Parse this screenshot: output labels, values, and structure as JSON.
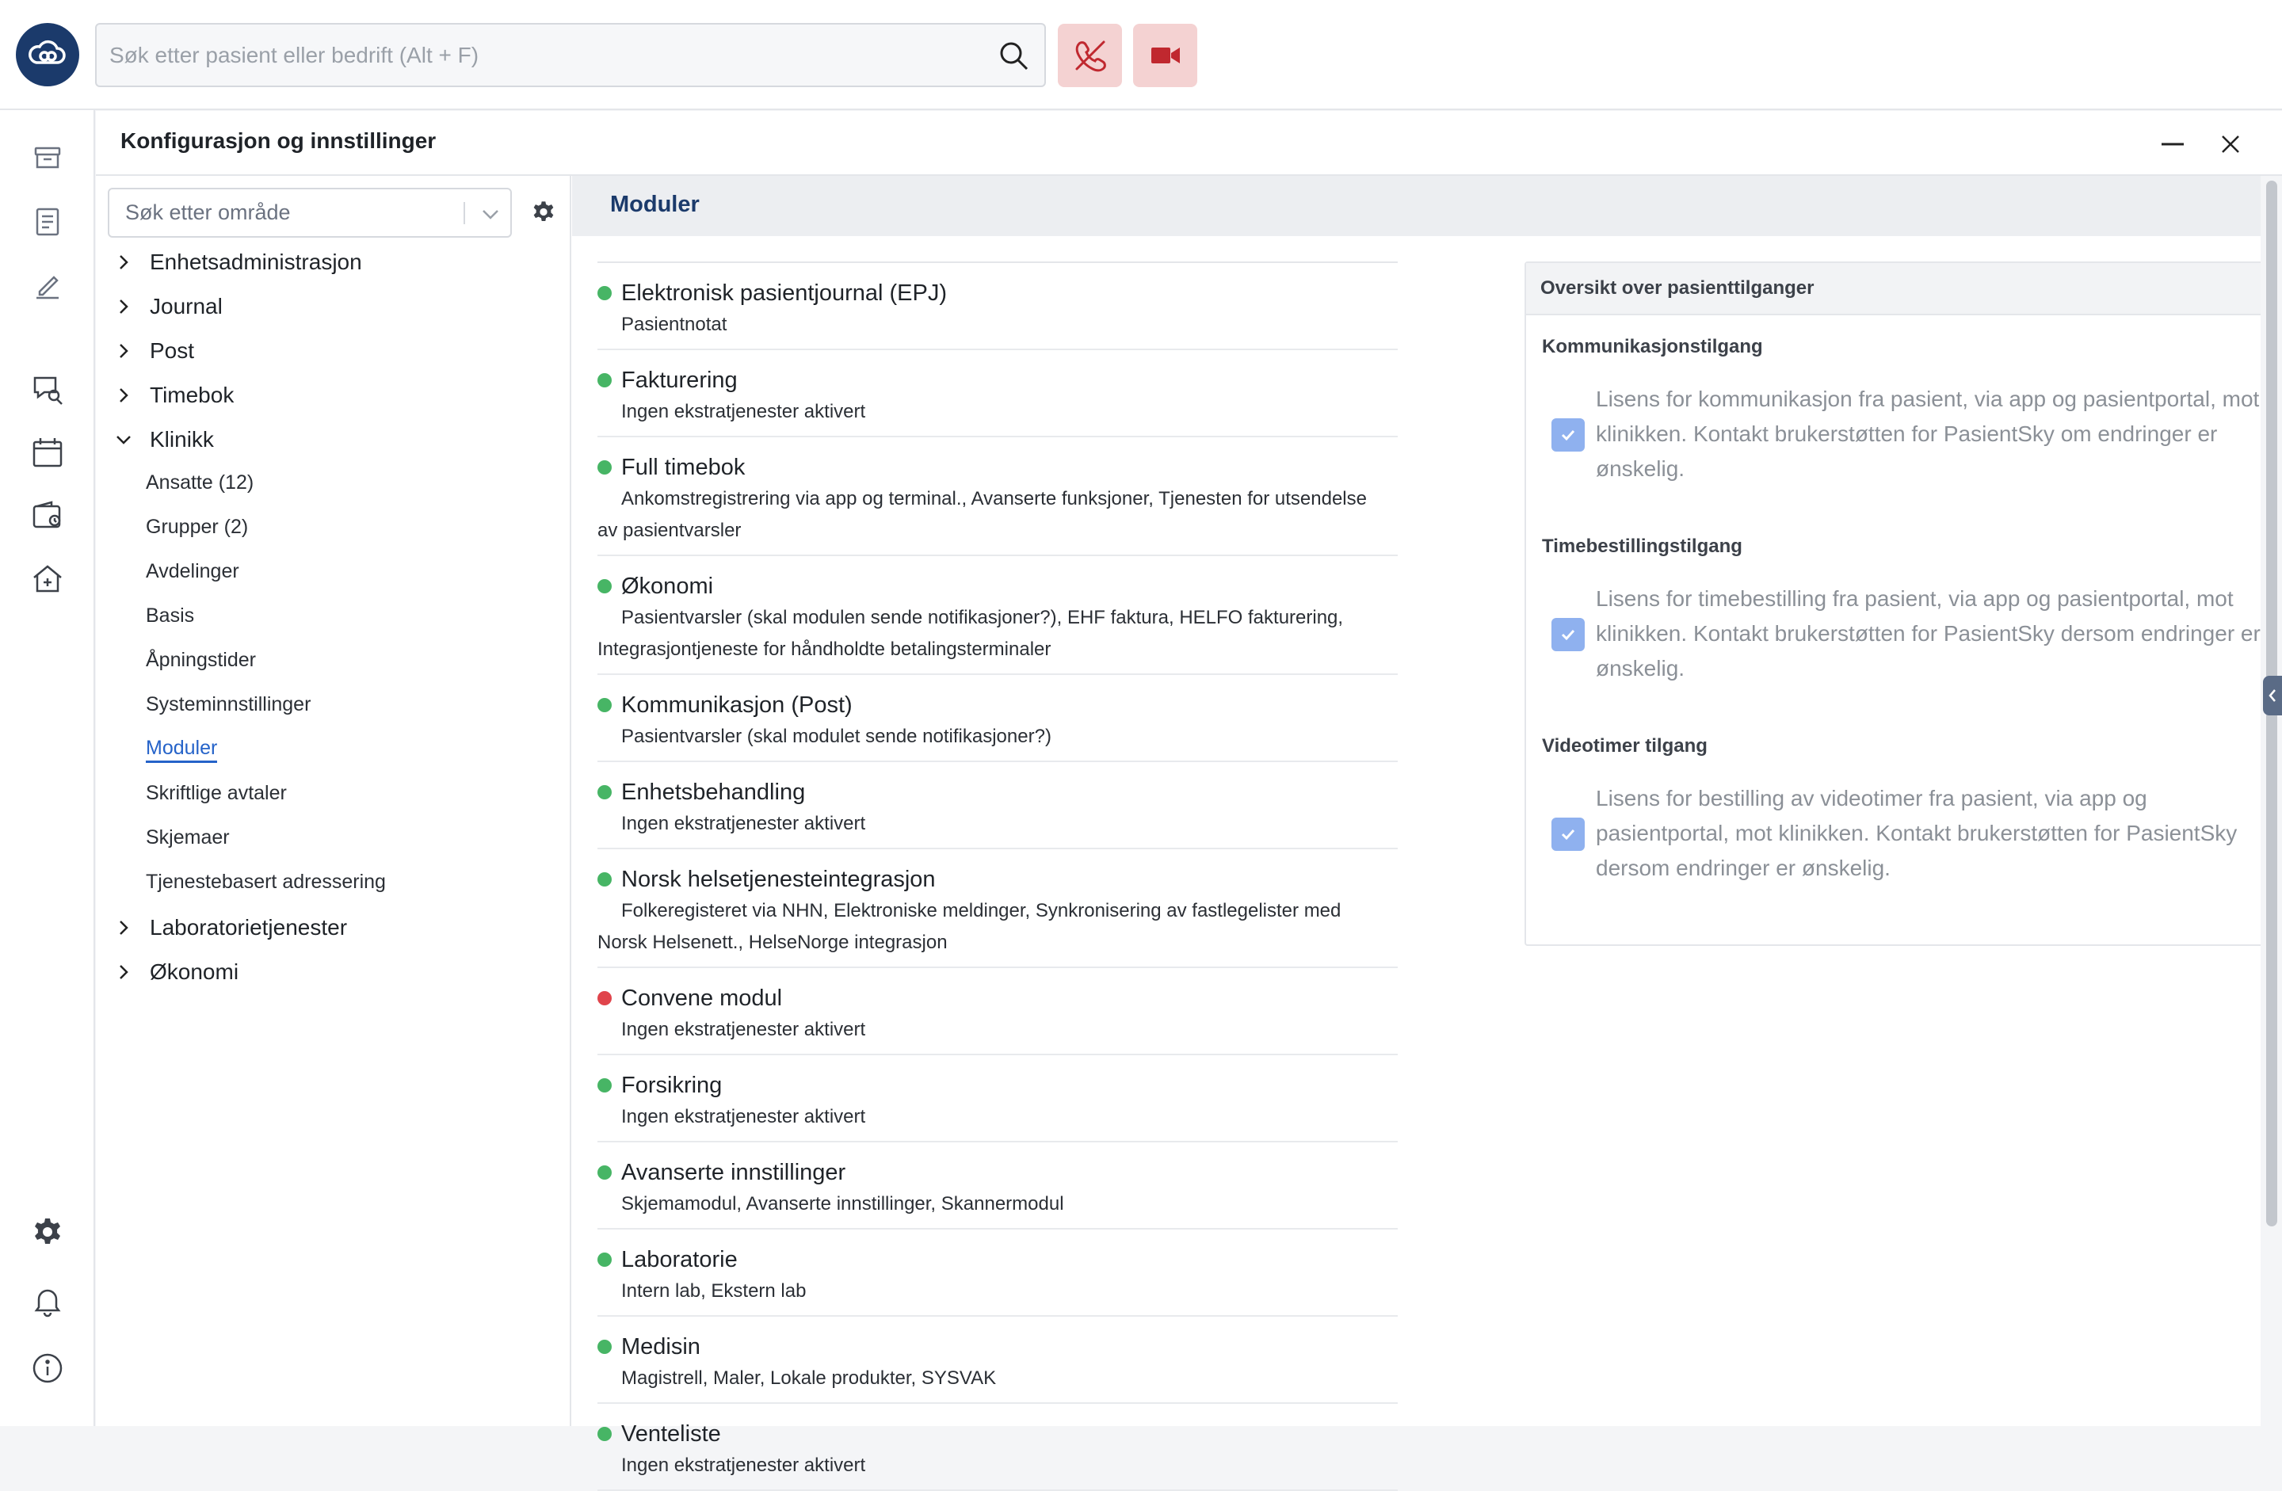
{
  "search": {
    "placeholder": "Søk etter pasient eller bedrift (Alt + F)"
  },
  "panel": {
    "title": "Konfigurasjon og innstillinger"
  },
  "tree": {
    "search_placeholder": "Søk etter område",
    "nodes": [
      {
        "label": "Enhetsadministrasjon",
        "expanded": false
      },
      {
        "label": "Journal",
        "expanded": false
      },
      {
        "label": "Post",
        "expanded": false
      },
      {
        "label": "Timebok",
        "expanded": false
      },
      {
        "label": "Klinikk",
        "expanded": true
      },
      {
        "label": "Laboratorietjenester",
        "expanded": false
      },
      {
        "label": "Økonomi",
        "expanded": false
      }
    ],
    "klinikk_items": [
      "Ansatte (12)",
      "Grupper (2)",
      "Avdelinger",
      "Basis",
      "Åpningstider",
      "Systeminnstillinger",
      "Moduler",
      "Skriftlige avtaler",
      "Skjemaer",
      "Tjenestebasert adressering"
    ],
    "active_item": "Moduler"
  },
  "content": {
    "title": "Moduler",
    "modules": [
      {
        "name": "Elektronisk pasientjournal (EPJ)",
        "desc": "Pasientnotat",
        "active": true
      },
      {
        "name": "Fakturering",
        "desc": "Ingen ekstratjenester aktivert",
        "active": true
      },
      {
        "name": "Full timebok",
        "desc": "Ankomstregistrering via app og terminal., Avanserte funksjoner, Tjenesten for utsendelse av pasientvarsler",
        "active": true
      },
      {
        "name": "Økonomi",
        "desc": "Pasientvarsler (skal modulen sende notifikasjoner?), EHF faktura, HELFO fakturering, Integrasjontjeneste for håndholdte betalingsterminaler",
        "active": true
      },
      {
        "name": "Kommunikasjon (Post)",
        "desc": "Pasientvarsler (skal modulet sende notifikasjoner?)",
        "active": true
      },
      {
        "name": "Enhetsbehandling",
        "desc": "Ingen ekstratjenester aktivert",
        "active": true
      },
      {
        "name": "Norsk helsetjenesteintegrasjon",
        "desc": "Folkeregisteret via NHN, Elektroniske meldinger, Synkronisering av fastlegelister med Norsk Helsenett., HelseNorge integrasjon",
        "active": true
      },
      {
        "name": "Convene modul",
        "desc": "Ingen ekstratjenester aktivert",
        "active": false
      },
      {
        "name": "Forsikring",
        "desc": "Ingen ekstratjenester aktivert",
        "active": true
      },
      {
        "name": "Avanserte innstillinger",
        "desc": "Skjemamodul, Avanserte innstillinger, Skannermodul",
        "active": true
      },
      {
        "name": "Laboratorie",
        "desc": "Intern lab, Ekstern lab",
        "active": true
      },
      {
        "name": "Medisin",
        "desc": "Magistrell, Maler, Lokale produkter, SYSVAK",
        "active": true
      },
      {
        "name": "Venteliste",
        "desc": "Ingen ekstratjenester aktivert",
        "active": true
      }
    ]
  },
  "access_card": {
    "title": "Oversikt over pasienttilganger",
    "sections": [
      {
        "title": "Kommunikasjonstilgang",
        "text": "Lisens for kommunikasjon fra pasient, via app og pasientportal, mot klinikken. Kontakt brukerstøtten for PasientSky om endringer er ønskelig.",
        "checked": true
      },
      {
        "title": "Timebestillingstilgang",
        "text": "Lisens for timebestilling fra pasient, via app og pasientportal, mot klinikken. Kontakt brukerstøtten for PasientSky dersom endringer er ønskelig.",
        "checked": true
      },
      {
        "title": "Videotimer tilgang",
        "text": "Lisens for bestilling av videotimer fra pasient, via app og pasientportal, mot klinikken. Kontakt brukerstøtten for PasientSky dersom endringer er ønskelig.",
        "checked": true
      }
    ]
  },
  "colors": {
    "brand": "#1b3a6b",
    "accent": "#2563c9",
    "active_dot": "#47b565",
    "inactive_dot": "#e0444b",
    "alert_button_bg": "#f4d2d2",
    "alert_icon": "#c0282f"
  },
  "icons": {
    "topbar": [
      "cloud-logo-icon",
      "search-icon",
      "call-off-icon",
      "video-camera-icon"
    ],
    "rail": [
      "archive-icon",
      "document-icon",
      "pen-icon",
      "chat-search-icon",
      "calendar-icon",
      "wallet-icon",
      "clinic-icon",
      "settings-icon",
      "bell-icon",
      "info-icon"
    ]
  }
}
